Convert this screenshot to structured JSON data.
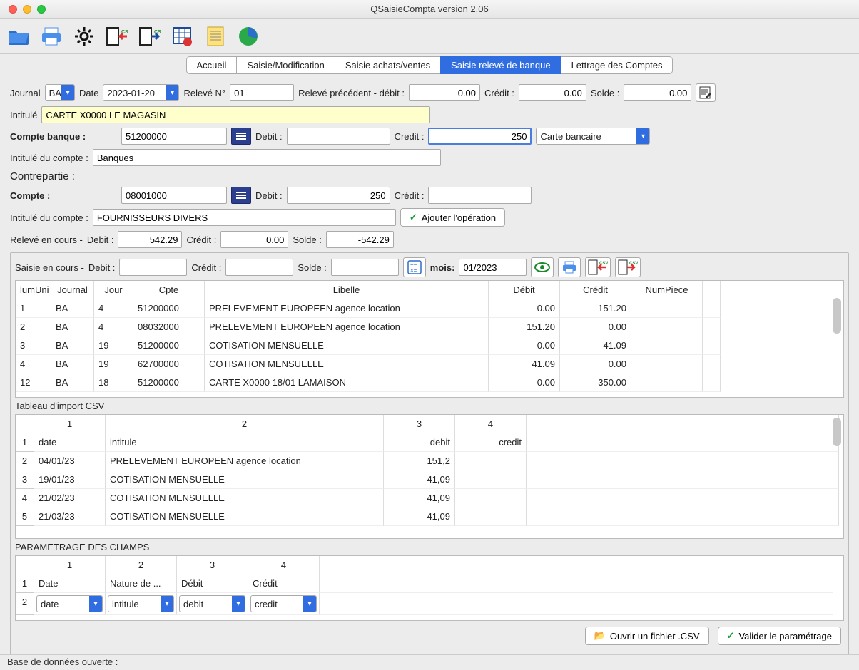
{
  "window": {
    "title": "QSaisieCompta version 2.06"
  },
  "tabs": [
    "Accueil",
    "Saisie/Modification",
    "Saisie achats/ventes",
    "Saisie relevé de banque",
    "Lettrage des Comptes"
  ],
  "active_tab": 3,
  "form": {
    "journal_label": "Journal",
    "journal_value": "BA",
    "date_label": "Date",
    "date_value": "2023-01-20",
    "releve_no_label": "Relevé N°",
    "releve_no_value": "01",
    "releve_prec_label": "Relevé précédent - débit :",
    "releve_prec_debit": "0.00",
    "credit_label": "Crédit :",
    "releve_prec_credit": "0.00",
    "solde_label": "Solde :",
    "releve_prec_solde": "0.00",
    "intitule_label": "Intitulé",
    "intitule_value": "CARTE X0000 LE MAGASIN",
    "compte_banque_label": "Compte banque  :",
    "compte_banque_value": "51200000",
    "debit_label": "Debit :",
    "banque_debit": "",
    "credit_label2": "Credit :",
    "banque_credit": "250",
    "payment_method": "Carte bancaire",
    "intitule_compte_label": "Intitulé du compte :",
    "intitule_compte_value": "Banques",
    "contrepartie_label": "Contrepartie :",
    "compte_label": "Compte  :",
    "compte_value": "08001000",
    "contrepartie_debit": "250",
    "contrepartie_credit": "",
    "intitule_compte2_value": "FOURNISSEURS DIVERS",
    "add_op_label": "Ajouter l'opération",
    "releve_cours_label": "Relevé en cours -",
    "releve_cours_debit_label": "Debit :",
    "releve_cours_debit": "542.29",
    "releve_cours_credit_label": "Crédit :",
    "releve_cours_credit": "0.00",
    "releve_cours_solde_label": "Solde :",
    "releve_cours_solde": "-542.29",
    "saisie_cours_label": "Saisie en cours -",
    "saisie_debit_label": "Debit :",
    "saisie_debit": "",
    "saisie_credit_label": "Crédit :",
    "saisie_credit": "",
    "saisie_solde_label": "Solde :",
    "saisie_solde": "",
    "mois_label": "mois:",
    "mois_value": "01/2023"
  },
  "main_table": {
    "headers": [
      "lumUni",
      "Journal",
      "Jour",
      "Cpte",
      "Libelle",
      "Débit",
      "Crédit",
      "NumPiece"
    ],
    "rows": [
      {
        "n": "1",
        "j": "BA",
        "d": "4",
        "c": "51200000",
        "l": "PRELEVEMENT EUROPEEN agence location",
        "debit": "0.00",
        "credit": "151.20",
        "p": ""
      },
      {
        "n": "2",
        "j": "BA",
        "d": "4",
        "c": "08032000",
        "l": "PRELEVEMENT EUROPEEN agence location",
        "debit": "151.20",
        "credit": "0.00",
        "p": ""
      },
      {
        "n": "3",
        "j": "BA",
        "d": "19",
        "c": "51200000",
        "l": "COTISATION MENSUELLE",
        "debit": "0.00",
        "credit": "41.09",
        "p": ""
      },
      {
        "n": "4",
        "j": "BA",
        "d": "19",
        "c": "62700000",
        "l": "COTISATION MENSUELLE",
        "debit": "41.09",
        "credit": "0.00",
        "p": ""
      },
      {
        "n": "12",
        "j": "BA",
        "d": "18",
        "c": "51200000",
        "l": "CARTE X0000 18/01 LAMAISON",
        "debit": "0.00",
        "credit": "350.00",
        "p": ""
      }
    ]
  },
  "csv_import": {
    "title": "Tableau d'import CSV",
    "col_nums": [
      "1",
      "2",
      "3",
      "4"
    ],
    "headers": [
      "date",
      "intitule",
      "debit",
      "credit"
    ],
    "rows": [
      {
        "n": "1",
        "c0": "date",
        "c1": "intitule",
        "c2": "debit",
        "c3": "credit"
      },
      {
        "n": "2",
        "c0": "04/01/23",
        "c1": "PRELEVEMENT EUROPEEN agence location",
        "c2": "151,2",
        "c3": ""
      },
      {
        "n": "3",
        "c0": "19/01/23",
        "c1": "COTISATION MENSUELLE",
        "c2": "41,09",
        "c3": ""
      },
      {
        "n": "4",
        "c0": "21/02/23",
        "c1": "COTISATION MENSUELLE",
        "c2": "41,09",
        "c3": ""
      },
      {
        "n": "5",
        "c0": "21/03/23",
        "c1": "COTISATION MENSUELLE",
        "c2": "41,09",
        "c3": ""
      }
    ]
  },
  "param": {
    "title": "PARAMETRAGE DES CHAMPS",
    "col_nums": [
      "1",
      "2",
      "3",
      "4"
    ],
    "row1": [
      "Date",
      "Nature de ...",
      "Débit",
      "Crédit"
    ],
    "row2": [
      "date",
      "intitule",
      "debit",
      "credit"
    ]
  },
  "buttons": {
    "open_csv": "Ouvrir un fichier .CSV",
    "validate": "Valider le paramétrage"
  },
  "statusbar": "Base de données ouverte :"
}
